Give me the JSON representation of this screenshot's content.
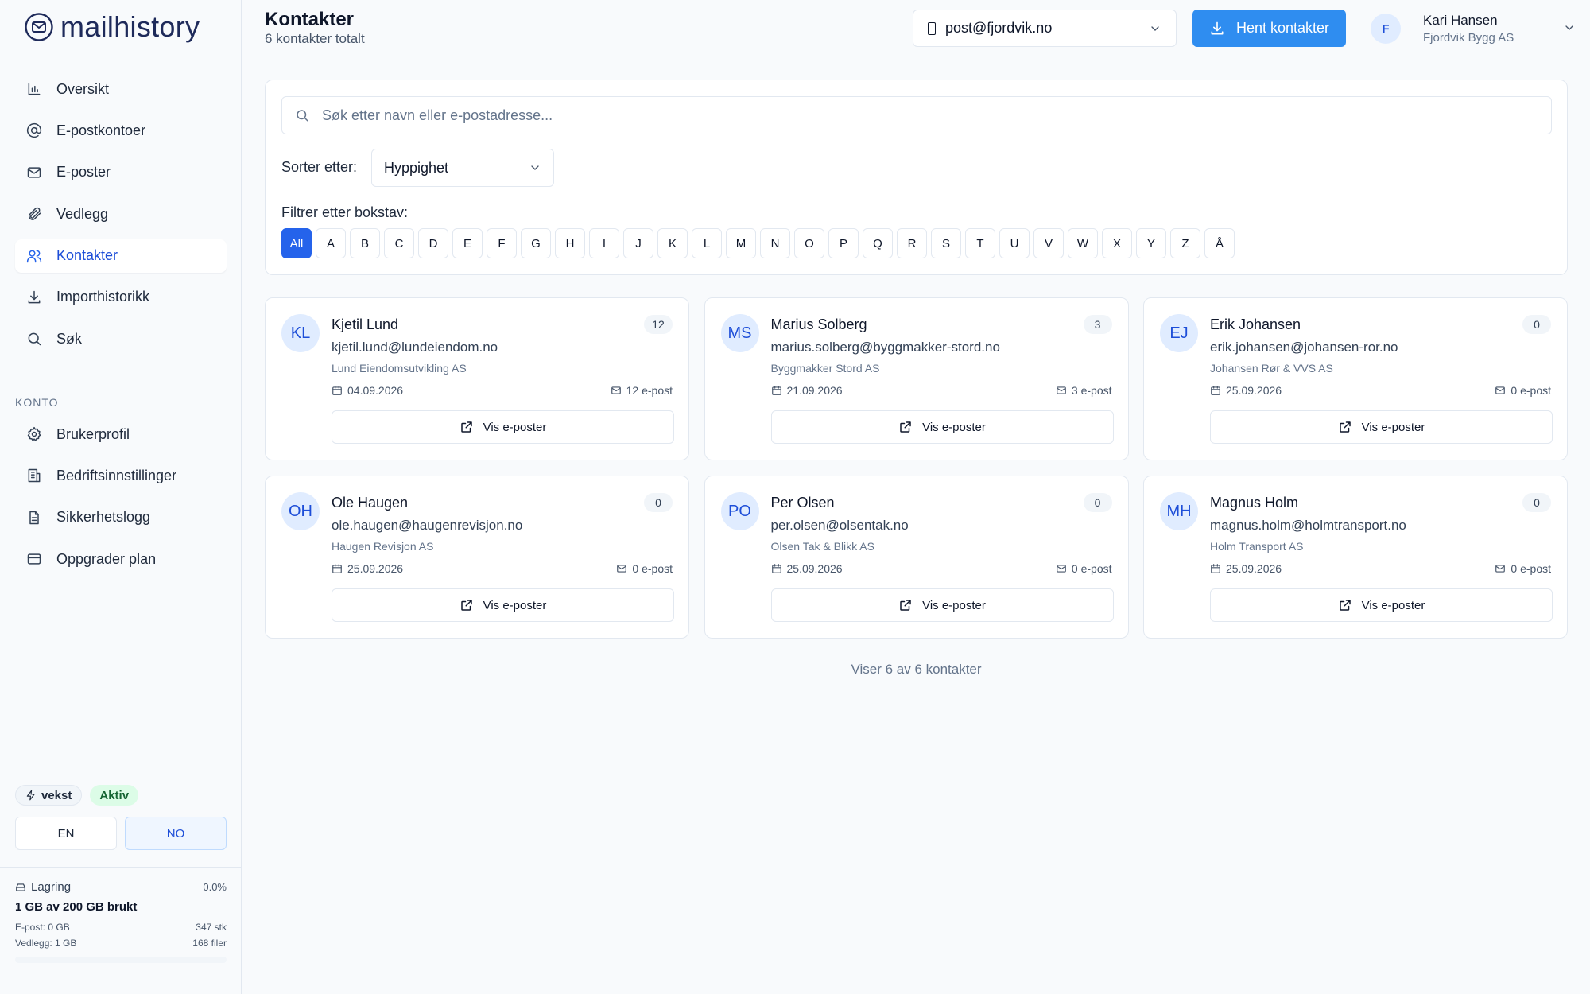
{
  "app": {
    "logo_text": "mailhistory"
  },
  "header": {
    "title": "Kontakter",
    "subtitle": "6 kontakter totalt",
    "account": "post@fjordvik.no",
    "fetch_label": "Hent kontakter",
    "user": {
      "initial": "F",
      "name": "Kari Hansen",
      "company": "Fjordvik Bygg AS"
    }
  },
  "sidebar": {
    "items": [
      {
        "label": "Oversikt",
        "icon": "bar-chart-icon"
      },
      {
        "label": "E-postkontoer",
        "icon": "at-sign-icon"
      },
      {
        "label": "E-poster",
        "icon": "mail-icon"
      },
      {
        "label": "Vedlegg",
        "icon": "paperclip-icon"
      },
      {
        "label": "Kontakter",
        "icon": "users-icon",
        "active": true
      },
      {
        "label": "Importhistorikk",
        "icon": "download-icon"
      },
      {
        "label": "Søk",
        "icon": "search-icon"
      }
    ],
    "section_label": "KONTO",
    "account_items": [
      {
        "label": "Brukerprofil",
        "icon": "gear-icon"
      },
      {
        "label": "Bedriftsinnstillinger",
        "icon": "building-icon"
      },
      {
        "label": "Sikkerhetslogg",
        "icon": "file-text-icon"
      },
      {
        "label": "Oppgrader plan",
        "icon": "credit-card-icon"
      }
    ],
    "plan": "vekst",
    "plan_status": "Aktiv",
    "lang_en": "EN",
    "lang_no": "NO",
    "storage": {
      "label": "Lagring",
      "percent": "0.0%",
      "percent_value": 0.0,
      "used": "1 GB av 200 GB brukt",
      "email_line": "E-post: 0 GB",
      "email_count": "347 stk",
      "attach_line": "Vedlegg: 1 GB",
      "attach_count": "168 filer"
    }
  },
  "filters": {
    "search_placeholder": "Søk etter navn eller e-postadresse...",
    "sort_label": "Sorter etter:",
    "sort_value": "Hyppighet",
    "letter_label": "Filtrer etter bokstav:",
    "letters": [
      "All",
      "A",
      "B",
      "C",
      "D",
      "E",
      "F",
      "G",
      "H",
      "I",
      "J",
      "K",
      "L",
      "M",
      "N",
      "O",
      "P",
      "Q",
      "R",
      "S",
      "T",
      "U",
      "V",
      "W",
      "X",
      "Y",
      "Z",
      "Å"
    ],
    "active_letter": "All"
  },
  "contacts": [
    {
      "initials": "KL",
      "name": "Kjetil Lund",
      "count": "12",
      "email": "kjetil.lund@lundeiendom.no",
      "company": "Lund Eiendomsutvikling AS",
      "date": "04.09.2026",
      "mail_count": "12 e-post",
      "button": "Vis e-poster"
    },
    {
      "initials": "MS",
      "name": "Marius Solberg",
      "count": "3",
      "email": "marius.solberg@byggmakker-stord.no",
      "company": "Byggmakker Stord AS",
      "date": "21.09.2026",
      "mail_count": "3 e-post",
      "button": "Vis e-poster"
    },
    {
      "initials": "EJ",
      "name": "Erik Johansen",
      "count": "0",
      "email": "erik.johansen@johansen-ror.no",
      "company": "Johansen Rør & VVS AS",
      "date": "25.09.2026",
      "mail_count": "0 e-post",
      "button": "Vis e-poster"
    },
    {
      "initials": "OH",
      "name": "Ole Haugen",
      "count": "0",
      "email": "ole.haugen@haugenrevisjon.no",
      "company": "Haugen Revisjon AS",
      "date": "25.09.2026",
      "mail_count": "0 e-post",
      "button": "Vis e-poster"
    },
    {
      "initials": "PO",
      "name": "Per Olsen",
      "count": "0",
      "email": "per.olsen@olsentak.no",
      "company": "Olsen Tak & Blikk AS",
      "date": "25.09.2026",
      "mail_count": "0 e-post",
      "button": "Vis e-poster"
    },
    {
      "initials": "MH",
      "name": "Magnus Holm",
      "count": "0",
      "email": "magnus.holm@holmtransport.no",
      "company": "Holm Transport AS",
      "date": "25.09.2026",
      "mail_count": "0 e-post",
      "button": "Vis e-poster"
    }
  ],
  "footer": {
    "showing": "Viser 6 av 6 kontakter"
  }
}
